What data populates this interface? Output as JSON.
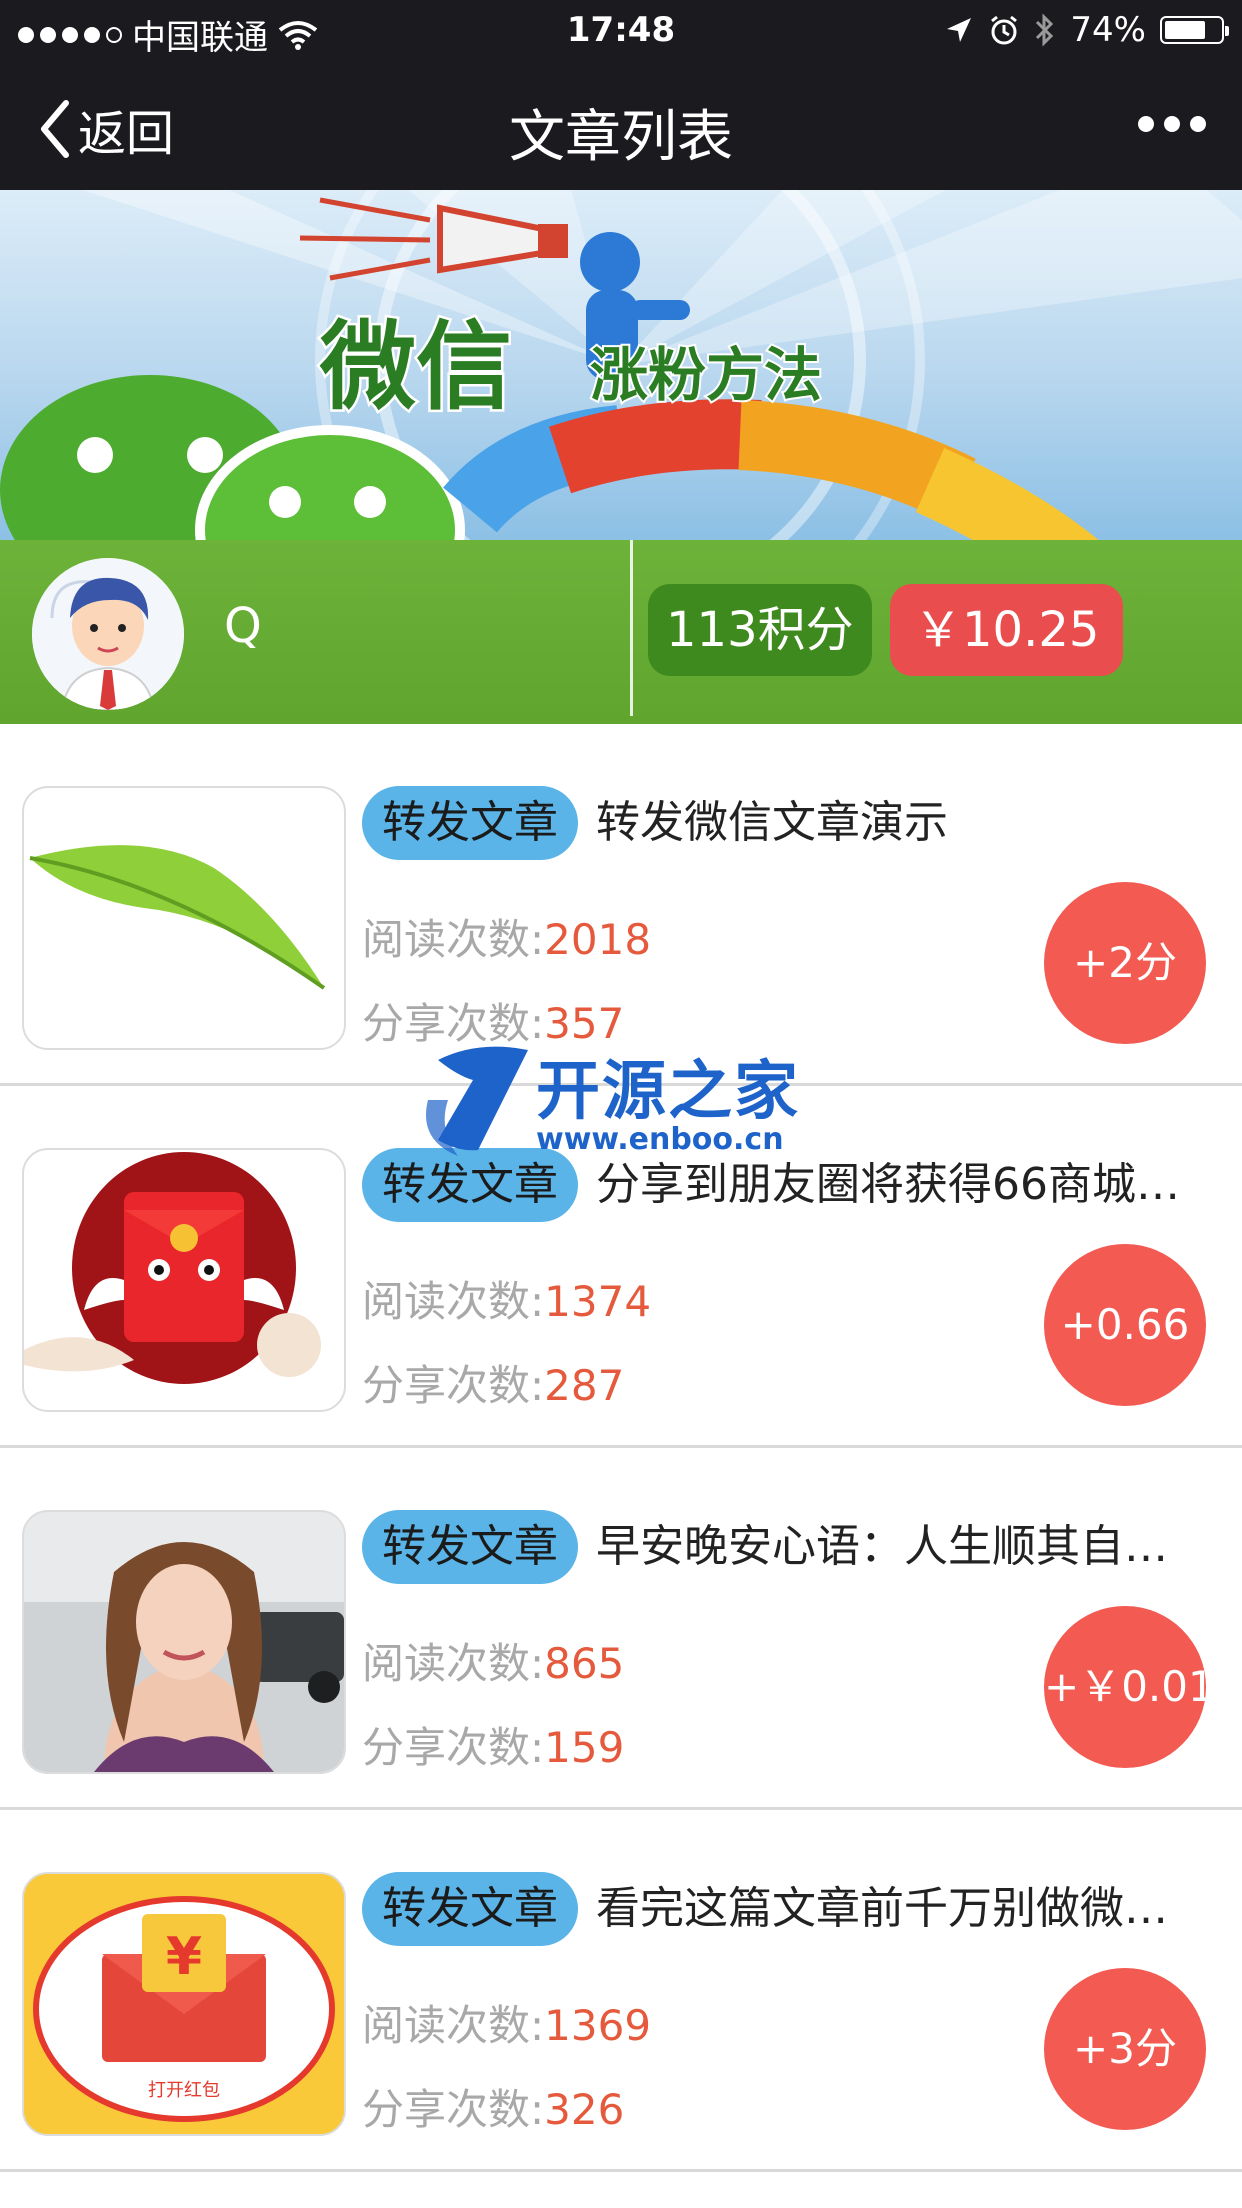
{
  "status_bar": {
    "carrier": "中国联通",
    "time": "17:48",
    "battery_percent": "74%",
    "battery_level": 0.74
  },
  "nav": {
    "back_label": "返回",
    "title": "文章列表"
  },
  "banner": {
    "heading_big": "微信",
    "heading_small": "涨粉方法"
  },
  "user": {
    "name": "Q",
    "points": "113积分",
    "balance": "￥10.25"
  },
  "articles": [
    {
      "tag": "转发文章",
      "title": "转发微信文章演示",
      "read_label": "阅读次数:",
      "reads": "2018",
      "share_label": "分享次数:",
      "shares": "357",
      "reward": "+2分"
    },
    {
      "tag": "转发文章",
      "title": "分享到朋友圈将获得66商城…",
      "read_label": "阅读次数:",
      "reads": "1374",
      "share_label": "分享次数:",
      "shares": "287",
      "reward": "+0.66"
    },
    {
      "tag": "转发文章",
      "title": "早安晚安心语：人生顺其自…",
      "read_label": "阅读次数:",
      "reads": "865",
      "share_label": "分享次数:",
      "shares": "159",
      "reward": "+￥0.01"
    },
    {
      "tag": "转发文章",
      "title": "看完这篇文章前千万别做微…",
      "read_label": "阅读次数:",
      "reads": "1369",
      "share_label": "分享次数:",
      "shares": "326",
      "reward": "+3分"
    }
  ],
  "redpacket_caption": "打开红包",
  "redpacket_symbol": "¥",
  "watermark": {
    "text": "开源之家",
    "url": "www.enboo.cn"
  },
  "colors": {
    "bar_bg": "#1b1b1f",
    "user_bar_green": "#64a832",
    "points_badge": "#3f8a1e",
    "money_badge": "#e94d4d",
    "tag_blue": "#5ab4e8",
    "reward_red": "#f25a52",
    "number_red": "#e55a3c"
  }
}
